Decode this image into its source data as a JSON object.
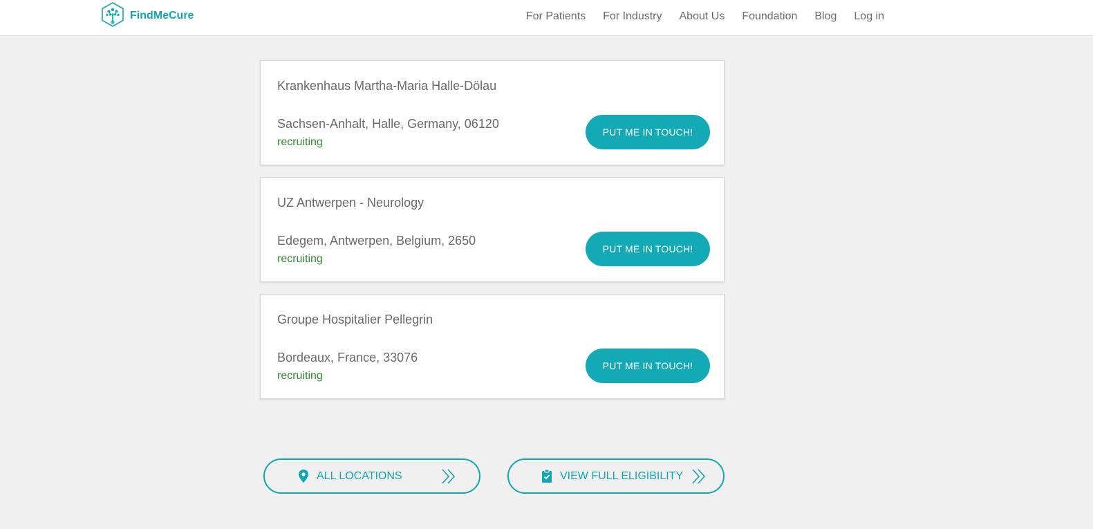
{
  "brand": {
    "name": "FindMeCure",
    "accent": "#13a5b1"
  },
  "nav": {
    "items": [
      {
        "label": "For Patients"
      },
      {
        "label": "For Industry"
      },
      {
        "label": "About Us"
      },
      {
        "label": "Foundation"
      },
      {
        "label": "Blog"
      },
      {
        "label": "Log in"
      }
    ]
  },
  "locations": [
    {
      "name": "Krankenhaus Martha-Maria Halle-Dölau",
      "address": "Sachsen-Anhalt, Halle, Germany, 06120",
      "status": "recruiting",
      "button_label": "PUT ME IN TOUCH!"
    },
    {
      "name": "UZ Antwerpen - Neurology",
      "address": "Edegem, Antwerpen, Belgium, 2650",
      "status": "recruiting",
      "button_label": "PUT ME IN TOUCH!"
    },
    {
      "name": "Groupe Hospitalier Pellegrin",
      "address": "Bordeaux, France, 33076",
      "status": "recruiting",
      "button_label": "PUT ME IN TOUCH!"
    }
  ],
  "actions": {
    "all_locations": {
      "label": "ALL LOCATIONS",
      "icon": "map-pin-icon"
    },
    "view_eligibility": {
      "label": "VIEW FULL ELIGIBILITY",
      "icon": "clipboard-check-icon"
    }
  },
  "colors": {
    "status_recruiting": "#2e8b2e",
    "button_fill": "#13aab5",
    "page_background": "#f0f0f0"
  }
}
